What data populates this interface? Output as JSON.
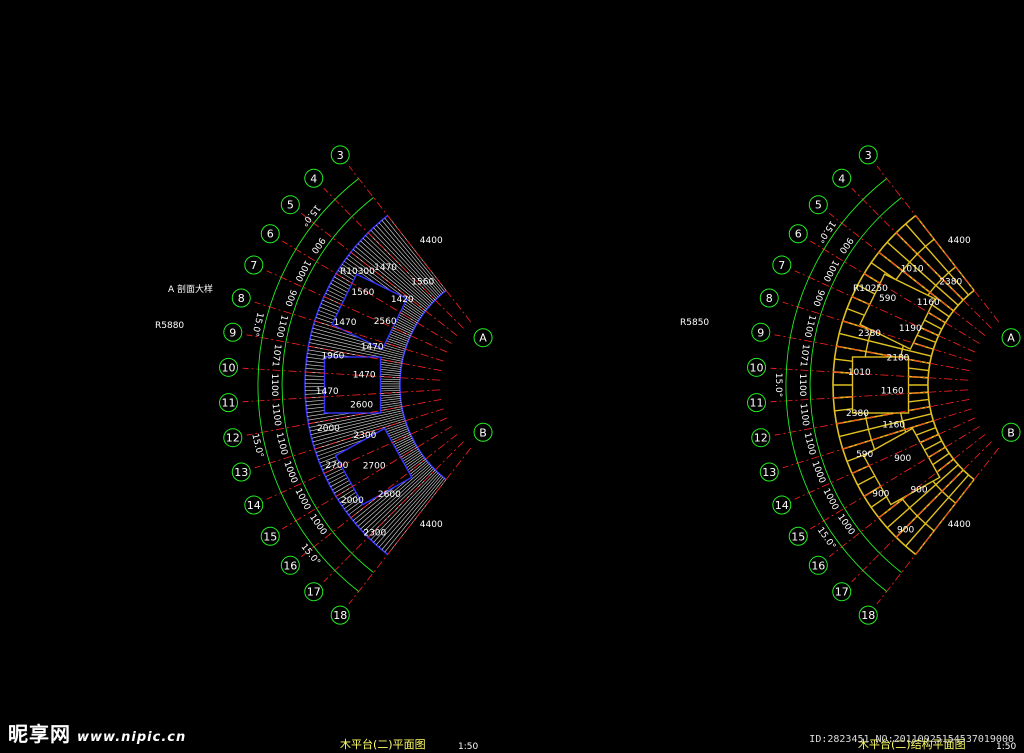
{
  "colors": {
    "background": "#000000",
    "grid_line": "#ff2020",
    "outline": "#3333ff",
    "decking": "#dddddd",
    "structure": "#e0c020",
    "dimension": "#22ee22",
    "text": "#ffffff"
  },
  "grid_labels": {
    "axis_a": "A",
    "axis_b": "B",
    "radials": [
      "3",
      "4",
      "5",
      "6",
      "7",
      "8",
      "9",
      "10",
      "11",
      "12",
      "13",
      "14",
      "15",
      "16",
      "17",
      "18"
    ]
  },
  "left_plan": {
    "title": "木平台(二)平面图",
    "scale": "1:50",
    "radius_outer": "R10300",
    "radius_inner": "R5880",
    "segment_angles": [
      "15.0°",
      "15.0°",
      "15.0°",
      "15.0°"
    ],
    "width_dims": [
      "4400",
      "4400"
    ],
    "opening_dims": [
      "1560",
      "1470",
      "1420",
      "1560",
      "2560",
      "1470",
      "1470",
      "1960",
      "1470",
      "1470"
    ],
    "board_dims": [
      "2600",
      "2000",
      "2300",
      "2700",
      "2700",
      "2000",
      "2600",
      "2300"
    ],
    "arc_dims": [
      "900",
      "1000",
      "900",
      "1100",
      "1071",
      "1100",
      "1100",
      "1100",
      "1000",
      "1000",
      "1000"
    ],
    "section_mark": "A 剖面大样"
  },
  "right_plan": {
    "title": "木平台(二)结构平面图",
    "scale": "1:50",
    "radius_outer": "R10250",
    "radius_inner": "R5850",
    "segment_angles": [
      "15.0°",
      "15.0°",
      "15.0°"
    ],
    "width_dims": [
      "4400",
      "4400"
    ],
    "beam_dims": [
      "2380",
      "1010",
      "1160",
      "590",
      "1190",
      "2380",
      "2180",
      "1010",
      "1160",
      "2380",
      "1160",
      "590",
      "900",
      "900",
      "900",
      "900"
    ],
    "arc_dims": [
      "900",
      "1000",
      "900",
      "1100",
      "1071",
      "1100",
      "1100",
      "1100",
      "1000",
      "1000",
      "1000"
    ]
  },
  "watermark": {
    "brand": "昵享网",
    "url": "www.nipic.cn",
    "image_id": "ID:2823451 NO:20110925154537019000"
  }
}
